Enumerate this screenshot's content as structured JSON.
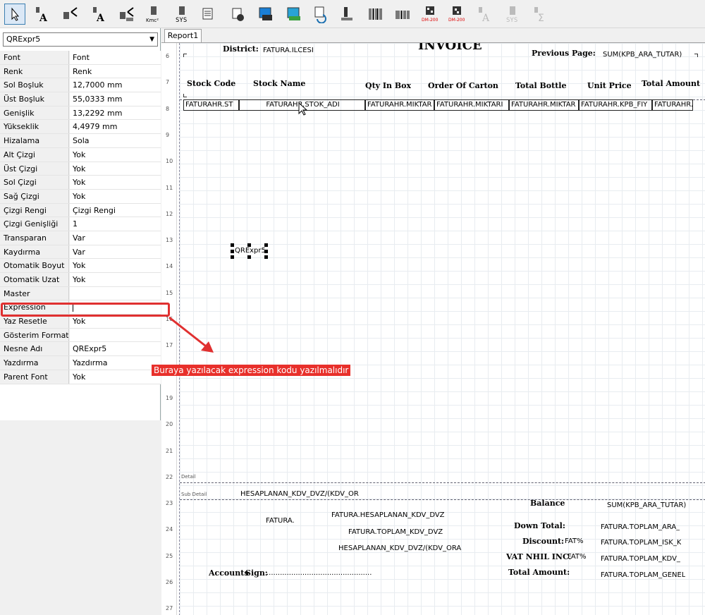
{
  "toolbar": {
    "items": [
      {
        "name": "select-pointer-tool",
        "text": ""
      },
      {
        "name": "label-tool",
        "text": ""
      },
      {
        "name": "rich-label-tool",
        "text": ""
      },
      {
        "name": "db-label-tool",
        "text": ""
      },
      {
        "name": "expression-tool",
        "text": ""
      },
      {
        "name": "formula-tool",
        "text": "Kmc²"
      },
      {
        "name": "sysdata-tool",
        "text": "SYS"
      },
      {
        "name": "memo-tool",
        "text": ""
      },
      {
        "name": "shape-tool",
        "text": ""
      },
      {
        "name": "image-tool",
        "text": ""
      },
      {
        "name": "db-image-tool",
        "text": ""
      },
      {
        "name": "child-band-tool",
        "text": ""
      },
      {
        "name": "summary-tool",
        "text": ""
      },
      {
        "name": "barcode-tool",
        "text": ""
      },
      {
        "name": "barcode2-tool",
        "text": ""
      },
      {
        "name": "datamatrix-tool",
        "text": "DM-200"
      },
      {
        "name": "datamatrix-db-tool",
        "text": "DM-200"
      },
      {
        "name": "disabled-label-tool",
        "text": ""
      },
      {
        "name": "disabled-sys-tool",
        "text": "SYS"
      },
      {
        "name": "disabled-sum-tool",
        "text": ""
      }
    ]
  },
  "left_panel": {
    "component_select": "QRExpr5",
    "properties": [
      {
        "key": "Font",
        "value": "Font"
      },
      {
        "key": "Renk",
        "value": "Renk"
      },
      {
        "key": "Sol Boşluk",
        "value": "12,7000 mm"
      },
      {
        "key": "Üst Boşluk",
        "value": "55,0333 mm"
      },
      {
        "key": "Genişlik",
        "value": "13,2292 mm"
      },
      {
        "key": "Yükseklik",
        "value": "4,4979 mm"
      },
      {
        "key": "Hizalama",
        "value": "Sola"
      },
      {
        "key": "Alt Çizgi",
        "value": "Yok"
      },
      {
        "key": "Üst Çizgi",
        "value": "Yok"
      },
      {
        "key": "Sol Çizgi",
        "value": "Yok"
      },
      {
        "key": "Sağ Çizgi",
        "value": "Yok"
      },
      {
        "key": "Çizgi Rengi",
        "value": "Çizgi Rengi"
      },
      {
        "key": "Çizgi Genişliği",
        "value": "1"
      },
      {
        "key": "Transparan",
        "value": "Var"
      },
      {
        "key": "Kaydırma",
        "value": "Var"
      },
      {
        "key": "Otomatik Boyut",
        "value": "Yok"
      },
      {
        "key": "Otomatik Uzat",
        "value": "Yok"
      },
      {
        "key": "Master",
        "value": ""
      },
      {
        "key": "Expression",
        "value": ""
      },
      {
        "key": "Yaz Resetle",
        "value": "Yok"
      },
      {
        "key": "Gösterim Formatı",
        "value": ""
      },
      {
        "key": "Nesne Adı",
        "value": "QRExpr5"
      },
      {
        "key": "Yazdırma",
        "value": "Yazdırma"
      },
      {
        "key": "Parent Font",
        "value": "Yok"
      }
    ]
  },
  "tabs": [
    "Report1"
  ],
  "ruler": [
    "6",
    "7",
    "8",
    "9",
    "10",
    "11",
    "12",
    "13",
    "14",
    "15",
    "16",
    "17",
    "18",
    "19",
    "20",
    "21",
    "22",
    "23",
    "24",
    "25",
    "26",
    "27"
  ],
  "report": {
    "header": {
      "district_label": "District:",
      "district_value": "FATURA.ILCESI",
      "title": "INVOICE",
      "previous_page_label": "Previous Page:",
      "previous_page_value": "SUM(KPB_ARA_TUTAR)"
    },
    "columns": [
      "Stock Code",
      "Stock Name",
      "Qty In Box",
      "Order Of Carton",
      "Total Bottle",
      "Unit Price",
      "Total Amount"
    ],
    "detail_fields": [
      "FATURAHR.ST",
      "FATURAHR.STOK_ADI",
      "FATURAHR.MIKTAR",
      "FATURAHR.MIKTARI",
      "FATURAHR.MIKTAR",
      "FATURAHR.KPB_FIY",
      "FATURAHR."
    ],
    "selected_component": "QRExpr5",
    "detail_band_label": "Detail",
    "subdetail_band_label": "Sub Detail",
    "subdetail_expr": "HESAPLANAN_KDV_DVZ/(KDV_OR",
    "footer": {
      "fatura": "FATURA.",
      "hesaplanan_kdv": "FATURA.HESAPLANAN_KDV_DVZ",
      "toplam_kdv": "FATURA.TOPLAM_KDV_DVZ",
      "hesaplanan_expr": "HESAPLANAN_KDV_DVZ/(KDV_ORA",
      "accounts_label": "Accounts",
      "sign_label": "Sign:",
      "sign_dots": "...............................................",
      "balance_label": "Balance",
      "balance_value": "SUM(KPB_ARA_TUTAR)",
      "down_total_label": "Down Total:",
      "down_total_value": "FATURA.TOPLAM_ARA_",
      "discount_label": "Discount:",
      "discount_pct": "FAT%",
      "discount_value": "FATURA.TOPLAM_ISK_K",
      "vat_label": "VAT NHIL INC.",
      "vat_pct": "FAT%",
      "vat_value": "FATURA.TOPLAM_KDV_",
      "total_label": "Total Amount:",
      "total_value": "FATURA.TOPLAM_GENEL"
    }
  },
  "annotation": {
    "text": "Buraya yazılacak expression kodu yazılmalıdır",
    "color": "#e8302b"
  }
}
